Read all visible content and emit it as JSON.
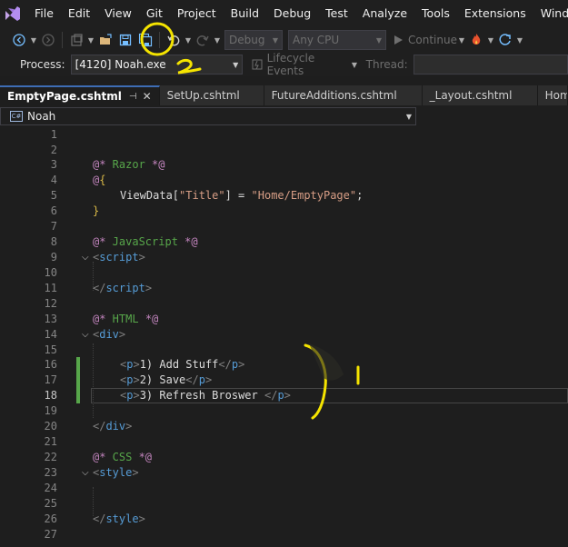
{
  "menu": {
    "items": [
      "File",
      "Edit",
      "View",
      "Git",
      "Project",
      "Build",
      "Debug",
      "Test",
      "Analyze",
      "Tools",
      "Extensions",
      "Window"
    ]
  },
  "toolbar": {
    "config": "Debug",
    "platform": "Any CPU",
    "continue_label": "Continue"
  },
  "process_bar": {
    "process_label": "Process:",
    "process_value": "[4120] Noah.exe",
    "lifecycle_label": "Lifecycle Events",
    "thread_label": "Thread:"
  },
  "tabs": [
    {
      "label": "EmptyPage.cshtml",
      "active": true
    },
    {
      "label": "SetUp.cshtml",
      "active": false
    },
    {
      "label": "FutureAdditions.cshtml",
      "active": false
    },
    {
      "label": "_Layout.cshtml",
      "active": false
    },
    {
      "label": "HomeCo",
      "active": false
    }
  ],
  "navbar": {
    "project": "Noah"
  },
  "editor": {
    "current_line": 18,
    "line_numbers": [
      "1",
      "2",
      "3",
      "4",
      "5",
      "6",
      "7",
      "8",
      "9",
      "10",
      "11",
      "12",
      "13",
      "14",
      "15",
      "16",
      "17",
      "18",
      "19",
      "20",
      "21",
      "22",
      "23",
      "24",
      "25",
      "26",
      "27"
    ],
    "code": {
      "l3_a": "@*",
      "l3_b": " Razor ",
      "l3_c": "*@",
      "l4_a": "@",
      "l4_b": "{",
      "l5_a": "ViewData",
      "l5_b": "[",
      "l5_c": "\"Title\"",
      "l5_d": "] = ",
      "l5_e": "\"Home/EmptyPage\"",
      "l5_f": ";",
      "l6": "}",
      "l8_a": "@*",
      "l8_b": " JavaScript ",
      "l8_c": "*@",
      "l9_a": "<",
      "l9_b": "script",
      "l9_c": ">",
      "l11_a": "</",
      "l11_b": "script",
      "l11_c": ">",
      "l13_a": "@*",
      "l13_b": " HTML ",
      "l13_c": "*@",
      "l14_a": "<",
      "l14_b": "div",
      "l14_c": ">",
      "l16_a": "<",
      "l16_b": "p",
      "l16_c": ">",
      "l16_d": "1) Add Stuff",
      "l16_e": "</",
      "l16_f": "p",
      "l16_g": ">",
      "l17_a": "<",
      "l17_b": "p",
      "l17_c": ">",
      "l17_d": "2) Save",
      "l17_e": "</",
      "l17_f": "p",
      "l17_g": ">",
      "l18_a": "<",
      "l18_b": "p",
      "l18_c": ">",
      "l18_d": "3) Refresh Broswer ",
      "l18_e": "</",
      "l18_f": "p",
      "l18_g": ">",
      "l20_a": "</",
      "l20_b": "div",
      "l20_c": ">",
      "l22_a": "@*",
      "l22_b": " CSS ",
      "l22_c": "*@",
      "l23_a": "<",
      "l23_b": "style",
      "l23_c": ">",
      "l26_a": "</",
      "l26_b": "style",
      "l26_c": ">"
    }
  },
  "colors": {
    "annotation": "#f5e400",
    "change_marker": "#57a64a",
    "tab_accent": "#3e6db5"
  },
  "icons": [
    "visual-studio-logo-icon",
    "back-icon",
    "forward-icon",
    "new-project-icon",
    "open-folder-icon",
    "save-icon",
    "save-all-icon",
    "undo-icon",
    "redo-icon",
    "play-icon",
    "hot-reload-icon",
    "restart-icon",
    "lightning-icon"
  ]
}
